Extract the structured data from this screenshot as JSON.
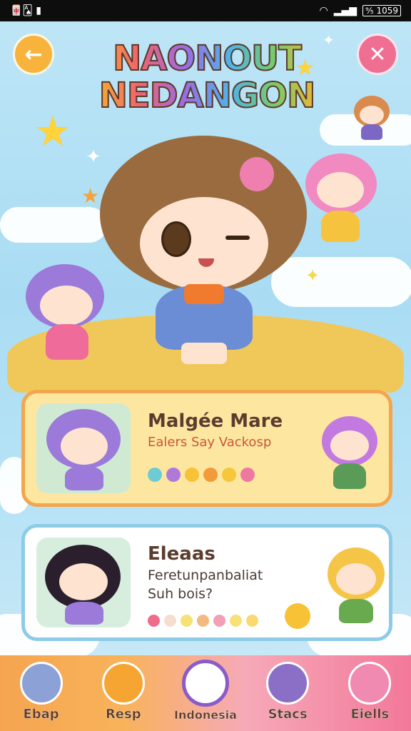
{
  "status_bar": {
    "left": "🀄🂡 ▮",
    "wifi": "wifi-icon",
    "battery_text": "⁹⁄₅ 1059",
    "signal": "signal-icon"
  },
  "header": {
    "title_line1": "NAONOUT",
    "title_line2": "NEDANGON",
    "back_icon": "arrow-left-icon",
    "close_icon": "close-icon"
  },
  "cards": [
    {
      "name": "Malgée Mare",
      "subtitle": "Ealers Say Vackosp",
      "colors": [
        "#6fcbd3",
        "#b079d9",
        "#f8c237",
        "#f39a3a",
        "#f6c63b",
        "#ee79a0"
      ]
    },
    {
      "name": "Eleaas",
      "subtitle_line1": "Feretunpanbaliat",
      "subtitle_line2": "Suh bois?",
      "colors": [
        "#f06a8a",
        "#f7dcd0",
        "#f8e077",
        "#f3b97f",
        "#f2a0b6",
        "#f8e077",
        "#f9d970"
      ]
    }
  ],
  "nav": [
    {
      "label": "Ebap",
      "icon": "profile-icon",
      "color": "#8ca1d6"
    },
    {
      "label": "Resp",
      "icon": "bear-icon",
      "color": "#f6a532"
    },
    {
      "label": "Indonesia",
      "icon": "smile-icon",
      "color": "#ffffff"
    },
    {
      "label": "Stacs",
      "icon": "star-creature-icon",
      "color": "#8b6fc7"
    },
    {
      "label": "Eiells",
      "icon": "pig-icon",
      "color": "#f08ab0"
    }
  ],
  "colors": {
    "accent_orange": "#f3a64b",
    "accent_pink": "#ef6f93",
    "accent_blue": "#8ecbe6"
  }
}
